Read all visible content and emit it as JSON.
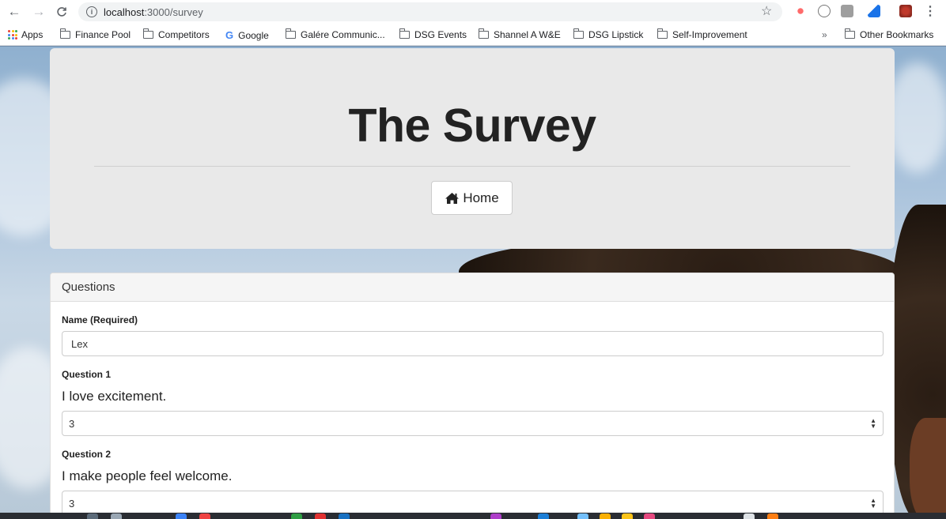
{
  "browser": {
    "url_host": "localhost",
    "url_path": ":3000/survey",
    "info_glyph": "i",
    "icons": [
      "back-arrow-icon",
      "forward-arrow-icon",
      "reload-icon",
      "info-icon",
      "star-icon",
      "menu-dots-icon"
    ]
  },
  "bookmarks": [
    {
      "label": "Apps",
      "icon": "apps-grid-icon"
    },
    {
      "label": "Finance Pool",
      "icon": "folder-icon"
    },
    {
      "label": "Competitors",
      "icon": "folder-icon"
    },
    {
      "label": "Google",
      "icon": "google-icon"
    },
    {
      "label": "Galére Communic...",
      "icon": "folder-icon"
    },
    {
      "label": "DSG Events",
      "icon": "folder-icon"
    },
    {
      "label": "Shannel A W&E",
      "icon": "folder-icon"
    },
    {
      "label": "DSG Lipstick",
      "icon": "folder-icon"
    },
    {
      "label": "Self-Improvement",
      "icon": "folder-icon"
    }
  ],
  "bookmarks_overflow": "»",
  "other_bookmarks": "Other Bookmarks",
  "jumbotron": {
    "title": "The Survey",
    "home_label": "Home"
  },
  "panel": {
    "heading": "Questions",
    "name_label": "Name (Required)",
    "name_value": "Lex",
    "questions": [
      {
        "label": "Question 1",
        "text": "I love excitement.",
        "selected": "3"
      },
      {
        "label": "Question 2",
        "text": "I make people feel welcome.",
        "selected": "3"
      }
    ]
  },
  "colors": {
    "jumbotron_bg": "#e9e9e9",
    "panel_heading_bg": "#f5f5f5",
    "text": "#222222"
  }
}
